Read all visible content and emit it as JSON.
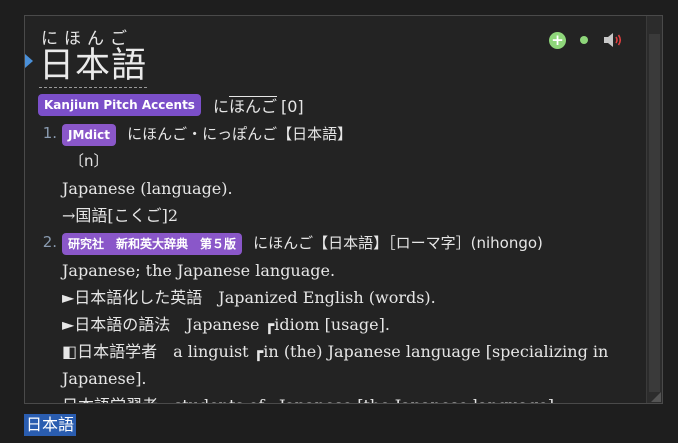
{
  "entry": {
    "reading": "にほんご",
    "headword": "日本語"
  },
  "pitch": {
    "badge": "Kanjium Pitch Accents",
    "reading_low": "に",
    "reading_high": "ほんご",
    "accent": "[0]"
  },
  "definitions": [
    {
      "number": "1.",
      "badge": "JMdict",
      "header": "にほんご・にっぽんご【日本語】",
      "lines": [
        "〔n〕",
        "Japanese (language).",
        "→国語[こくご]2"
      ]
    },
    {
      "number": "2.",
      "badge": "研究社　新和英大辞典　第５版",
      "header": "にほんご【日本語】［ローマ字］(nihongo)",
      "lines": [
        "Japanese; the Japanese language.",
        "►日本語化した英語　Japanized English (words).",
        "►日本語の語法　Japanese ┏idiom [usage].",
        "◧日本語学者　a linguist ┏in (the) Japanese language [specializing in",
        "Japanese].",
        "日本語学習者　students of ┏Japanese [the Japanese language]"
      ]
    }
  ],
  "selection_text": "日本語",
  "icons": [
    "add-icon",
    "dot-icon",
    "sound-icon"
  ],
  "colors": {
    "badge_purple": "#7b4fc9",
    "green": "#8ed67a",
    "selection_blue": "#2a5db0"
  }
}
